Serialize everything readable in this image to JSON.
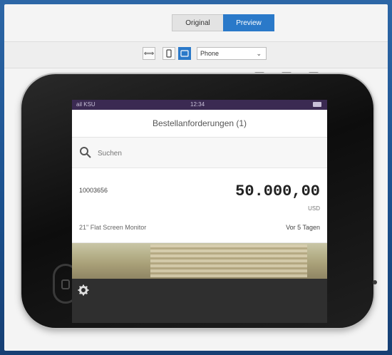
{
  "tabs": {
    "original": "Original",
    "preview": "Preview",
    "active": "preview"
  },
  "toolbar": {
    "fit_icon": "fit-width-icon",
    "phone_icon": "phone-portrait-icon",
    "tablet_icon": "tablet-icon",
    "device_select": "Phone"
  },
  "device": {
    "status": {
      "left": "ail KSU",
      "time": "12:34"
    },
    "header_title": "Bestellanforderungen (1)",
    "search_placeholder": "Suchen",
    "item": {
      "id": "10003656",
      "amount": "50.000,00",
      "currency": "USD",
      "description": "21\" Flat Screen Monitor",
      "age": "Vor 5 Tagen"
    },
    "footer_icon": "gear-icon"
  },
  "colors": {
    "accent": "#2a79c9",
    "statusbar": "#3b2a52",
    "background": "#1a4f8c"
  }
}
